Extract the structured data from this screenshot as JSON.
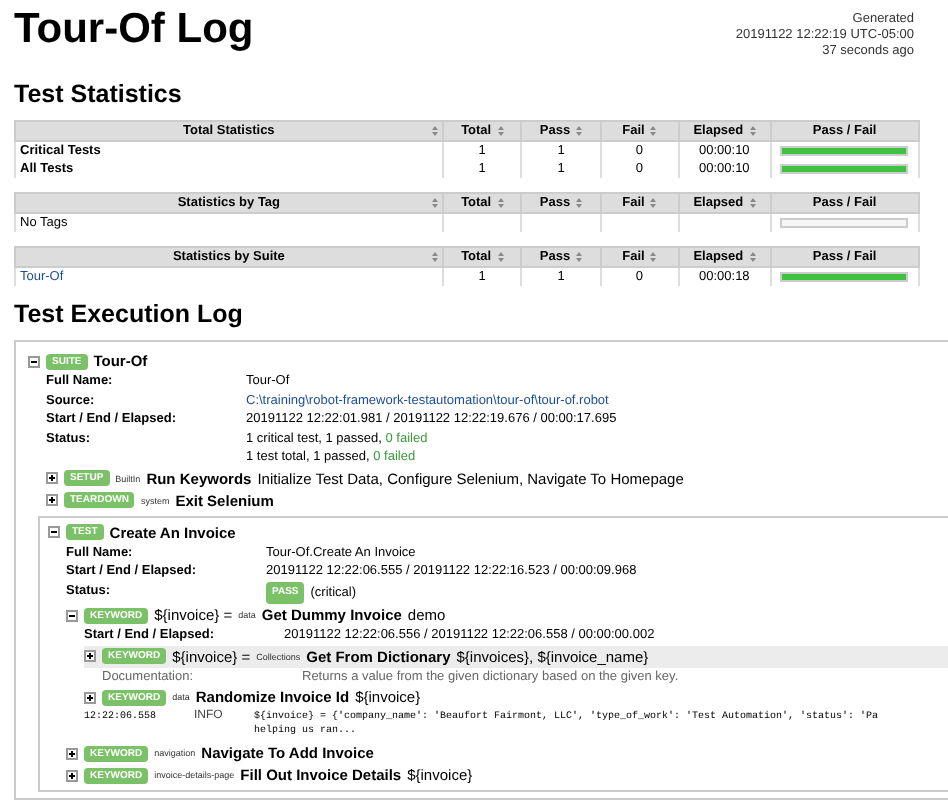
{
  "header": {
    "title": "Tour-Of Log",
    "generated": [
      "Generated",
      "20191122 12:22:19 UTC-05:00",
      "37 seconds ago"
    ]
  },
  "statistics": {
    "title": "Test Statistics",
    "tables": [
      {
        "columns": [
          "Total Statistics",
          "Total",
          "Pass",
          "Fail",
          "Elapsed",
          "Pass / Fail"
        ],
        "rows": [
          {
            "kind": "bold",
            "name": "Critical Tests",
            "total": "1",
            "pass": "1",
            "fail": "0",
            "elapsed": "00:00:10",
            "level": 1
          },
          {
            "kind": "bold",
            "name": "All Tests",
            "total": "1",
            "pass": "1",
            "fail": "0",
            "elapsed": "00:00:10",
            "level": 1
          }
        ]
      },
      {
        "columns": [
          "Statistics by Tag",
          "Total",
          "Pass",
          "Fail",
          "Elapsed",
          "Pass / Fail"
        ],
        "rows": [
          {
            "kind": "plain",
            "name": "No Tags"
          }
        ]
      },
      {
        "columns": [
          "Statistics by Suite",
          "Total",
          "Pass",
          "Fail",
          "Elapsed",
          "Pass / Fail"
        ],
        "rows": [
          {
            "kind": "link",
            "name": "Tour-Of",
            "total": "1",
            "pass": "1",
            "fail": "0",
            "elapsed": "00:00:18",
            "level": 1
          }
        ]
      }
    ]
  },
  "log": {
    "title": "Test Execution Log",
    "suite": {
      "badge": "SUITE",
      "expanded": true,
      "name": "Tour-Of",
      "info": [
        {
          "kind": "text",
          "key": "Full Name:",
          "value": "Tour-Of"
        },
        {
          "kind": "link",
          "key": "Source:",
          "value": "C:\\training\\robot-framework-testautomation\\tour-of\\tour-of.robot"
        },
        {
          "kind": "text",
          "key": "Start / End / Elapsed:",
          "value": "20191122 12:22:01.981 / 20191122 12:22:19.676 / 00:00:17.695"
        },
        {
          "kind": "lines",
          "key": "Status:",
          "lines": [
            {
              "text": "1 critical test, 1 passed, ",
              "failed": "0 failed"
            },
            {
              "text": "1 test total, 1 passed, ",
              "failed": "0 failed"
            }
          ]
        }
      ],
      "children": [
        {
          "badge": "SETUP",
          "expanded": false,
          "library": "BuiltIn",
          "name": "Run Keywords",
          "args": "Initialize Test Data, Configure Selenium, Navigate To Homepage"
        },
        {
          "badge": "TEARDOWN",
          "expanded": false,
          "library": "system",
          "name": "Exit Selenium"
        },
        {
          "badge": "TEST",
          "expanded": true,
          "boxed": true,
          "name": "Create An Invoice",
          "info": [
            {
              "kind": "text",
              "key": "Full Name:",
              "value": "Tour-Of.Create An Invoice"
            },
            {
              "kind": "text",
              "key": "Start / End / Elapsed:",
              "value": "20191122 12:22:06.555 / 20191122 12:22:16.523 / 00:00:09.968"
            },
            {
              "kind": "status",
              "key": "Status:",
              "badge": "PASS",
              "note": "(critical)"
            }
          ],
          "children": [
            {
              "badge": "KEYWORD",
              "expanded": true,
              "assign": "${invoice} =",
              "library": "data",
              "name": "Get Dummy Invoice",
              "args": "demo",
              "info": [
                {
                  "kind": "text",
                  "key": "Start / End / Elapsed:",
                  "value": "20191122 12:22:06.556 / 20191122 12:22:06.558 / 00:00:00.002"
                }
              ],
              "children": [
                {
                  "badge": "KEYWORD",
                  "expanded": false,
                  "highlighted": true,
                  "assign": "${invoice} =",
                  "library": "Collections",
                  "name": "Get From Dictionary",
                  "args": "${invoices}, ${invoice_name}",
                  "info": [
                    {
                      "kind": "doc",
                      "key": "Documentation:",
                      "value": "Returns a value from the given dictionary based on the given key."
                    }
                  ]
                },
                {
                  "badge": "KEYWORD",
                  "expanded": false,
                  "library": "data",
                  "name": "Randomize Invoice Id",
                  "args": "${invoice}"
                }
              ],
              "messages": [
                {
                  "time": "12:22:06.558",
                  "level": "INFO",
                  "lines": [
                    "${invoice} = {'company_name': 'Beaufort Fairmont, LLC', 'type_of_work': 'Test Automation', 'status': 'Pa",
                    "helping us ran..."
                  ]
                }
              ]
            },
            {
              "badge": "KEYWORD",
              "expanded": false,
              "library": "navigation",
              "name": "Navigate To Add Invoice"
            },
            {
              "badge": "KEYWORD",
              "expanded": false,
              "library": "invoice-details-page",
              "name": "Fill Out Invoice Details",
              "args": "${invoice}"
            }
          ]
        }
      ]
    }
  }
}
